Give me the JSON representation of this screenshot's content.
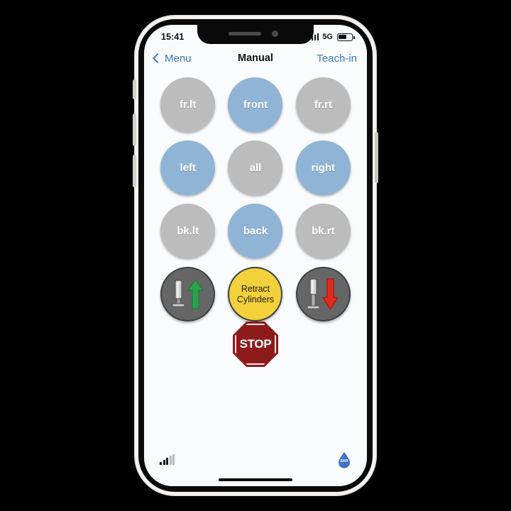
{
  "status_bar": {
    "time": "15:41",
    "cellular_icon": "cellular-bars-icon",
    "network": "5G",
    "battery_icon": "battery-icon",
    "battery_level_percent": 55
  },
  "nav_bar": {
    "back_icon": "chevron-left-icon",
    "back_label": "Menu",
    "title": "Manual",
    "action_label": "Teach-in",
    "link_color": "#3a77c8"
  },
  "colors": {
    "inactive_gray": "#bcbcbc",
    "active_blue": "#8fb4d6",
    "retract_yellow": "#f3d13b",
    "cylinder_dark": "#666666",
    "extend_arrow_green": "#2da04e",
    "retract_arrow_red": "#e02b1e",
    "stop_red": "#8e1b1b",
    "screen_bg": "#fafbfc"
  },
  "grid": {
    "buttons": [
      {
        "name": "fr-lt",
        "label": "fr.lt",
        "state": "inactive",
        "style": "gray"
      },
      {
        "name": "front",
        "label": "front",
        "state": "active",
        "style": "blue"
      },
      {
        "name": "fr-rt",
        "label": "fr.rt",
        "state": "inactive",
        "style": "gray"
      },
      {
        "name": "left",
        "label": "left",
        "state": "active",
        "style": "blue"
      },
      {
        "name": "all",
        "label": "all",
        "state": "inactive",
        "style": "gray"
      },
      {
        "name": "right",
        "label": "right",
        "state": "active",
        "style": "blue"
      },
      {
        "name": "bk-lt",
        "label": "bk.lt",
        "state": "inactive",
        "style": "gray"
      },
      {
        "name": "back",
        "label": "back",
        "state": "active",
        "style": "blue"
      },
      {
        "name": "bk-rt",
        "label": "bk.rt",
        "state": "inactive",
        "style": "gray"
      }
    ],
    "action_row": [
      {
        "name": "extend-cylinders",
        "icon": "cylinder-up-arrow-icon",
        "label": "",
        "style": "dark"
      },
      {
        "name": "retract-cylinders",
        "icon": "",
        "label": "Retract\nCylinders",
        "label_line1": "Retract",
        "label_line2": "Cylinders",
        "style": "yellow"
      },
      {
        "name": "lower-cylinders",
        "icon": "cylinder-down-arrow-icon",
        "label": "",
        "style": "dark"
      }
    ]
  },
  "stop_button": {
    "label": "STOP",
    "icon": "stop-sign-icon"
  },
  "footer": {
    "signal_icon": "signal-strength-icon",
    "signal_bars_on": 3,
    "signal_bars_total": 5,
    "brand_icon": "water-droplet-icon",
    "brand_text": "SHR"
  }
}
